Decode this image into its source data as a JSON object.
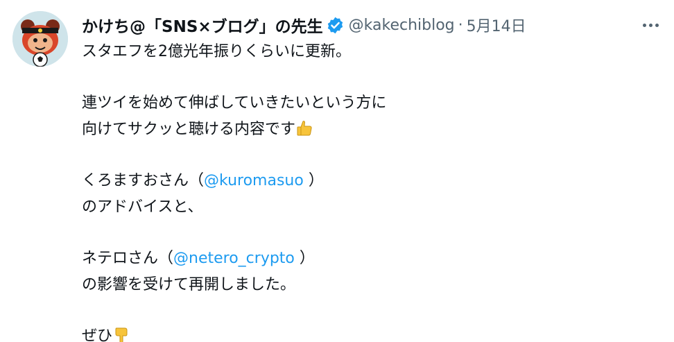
{
  "author": {
    "display_name": "かけち@「SNS×ブログ」の先生",
    "handle": "@kakechiblog",
    "separator": "·",
    "date": "5月14日",
    "verified_icon": "verified-badge-icon",
    "verified_color": "#1d9bf0"
  },
  "menu": {
    "icon": "more-horizontal-icon"
  },
  "tweet": {
    "line1": "スタエフを2億光年振りくらいに更新。",
    "line2": "連ツイを始めて伸ばしていきたいという方に",
    "line3": "向けてサクッと聴ける内容です",
    "line3_emoji": "thumbs-up-icon",
    "line4_pre": "くろますおさん（",
    "line4_mention": "@kuromasuo",
    "line4_post": " ）",
    "line5": "のアドバイスと、",
    "line6_pre": "ネテロさん（",
    "line6_mention": "@netero_crypto",
    "line6_post": " ）",
    "line7": "の影響を受けて再開しました。",
    "line8": "ぜひ",
    "line8_emoji": "pointing-down-icon"
  },
  "colors": {
    "text": "#0f1419",
    "secondary": "#536471",
    "link": "#1d9bf0",
    "emoji_yellow": "#f7c43b"
  }
}
